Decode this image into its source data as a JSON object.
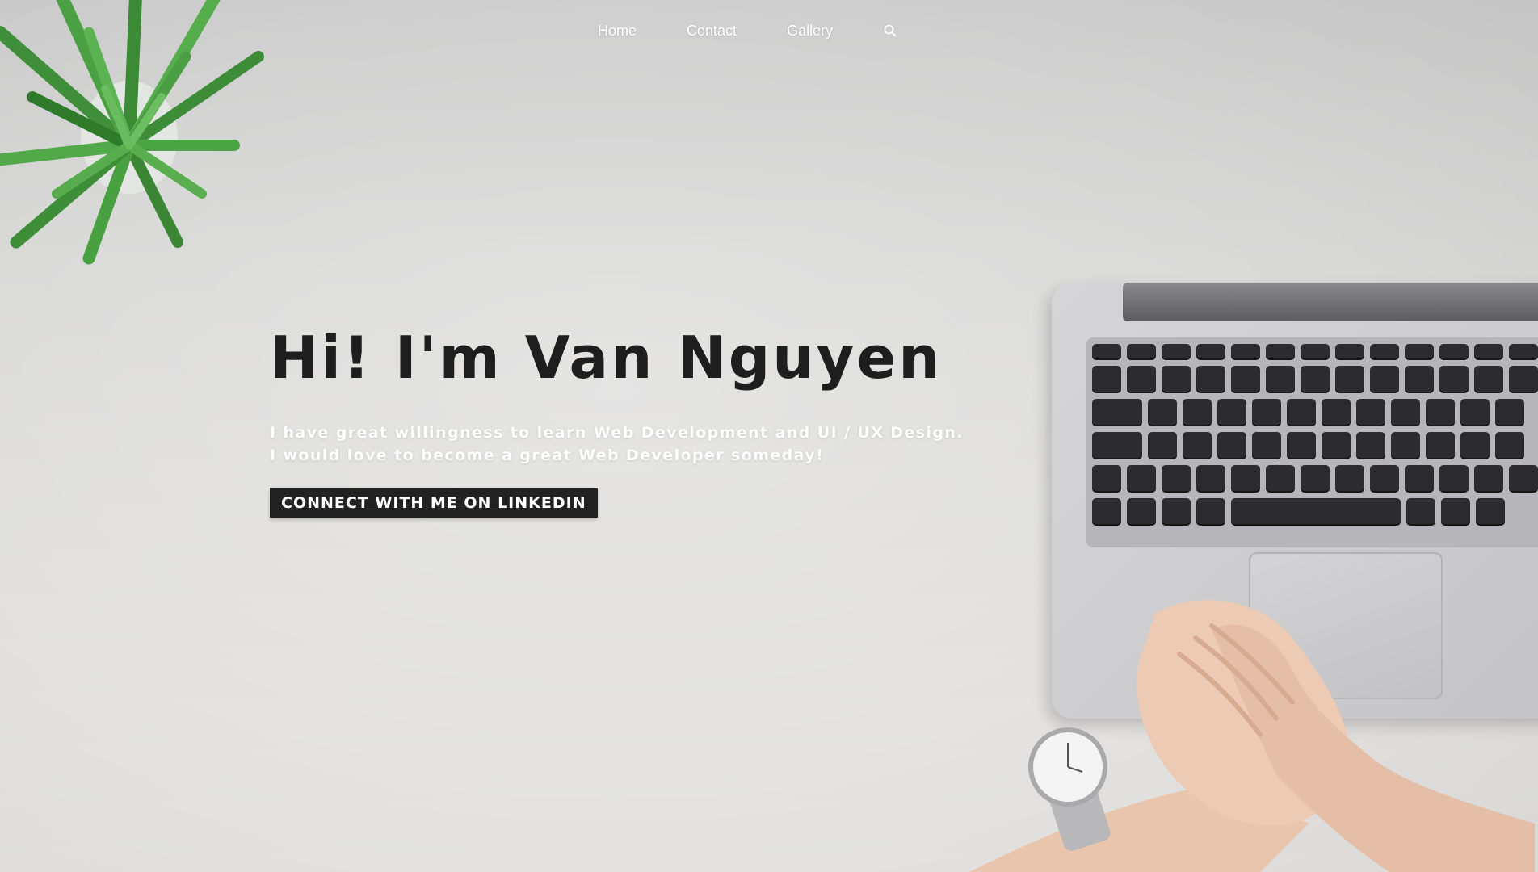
{
  "nav": {
    "items": [
      {
        "label": "Home"
      },
      {
        "label": "Contact"
      },
      {
        "label": "Gallery"
      }
    ],
    "search_icon": "search-icon"
  },
  "hero": {
    "title": "Hi! I'm Van Nguyen",
    "line1": "I have great willingness to learn Web Development and UI / UX Design.",
    "line2": "I would love to become a great Web Developer someday!",
    "cta_label": "CONNECT WITH ME ON LINKEDIN"
  },
  "colors": {
    "title": "#1e1e1e",
    "subtitle": "#ffffff",
    "cta_bg": "#222222",
    "nav_text": "#ffffff"
  }
}
